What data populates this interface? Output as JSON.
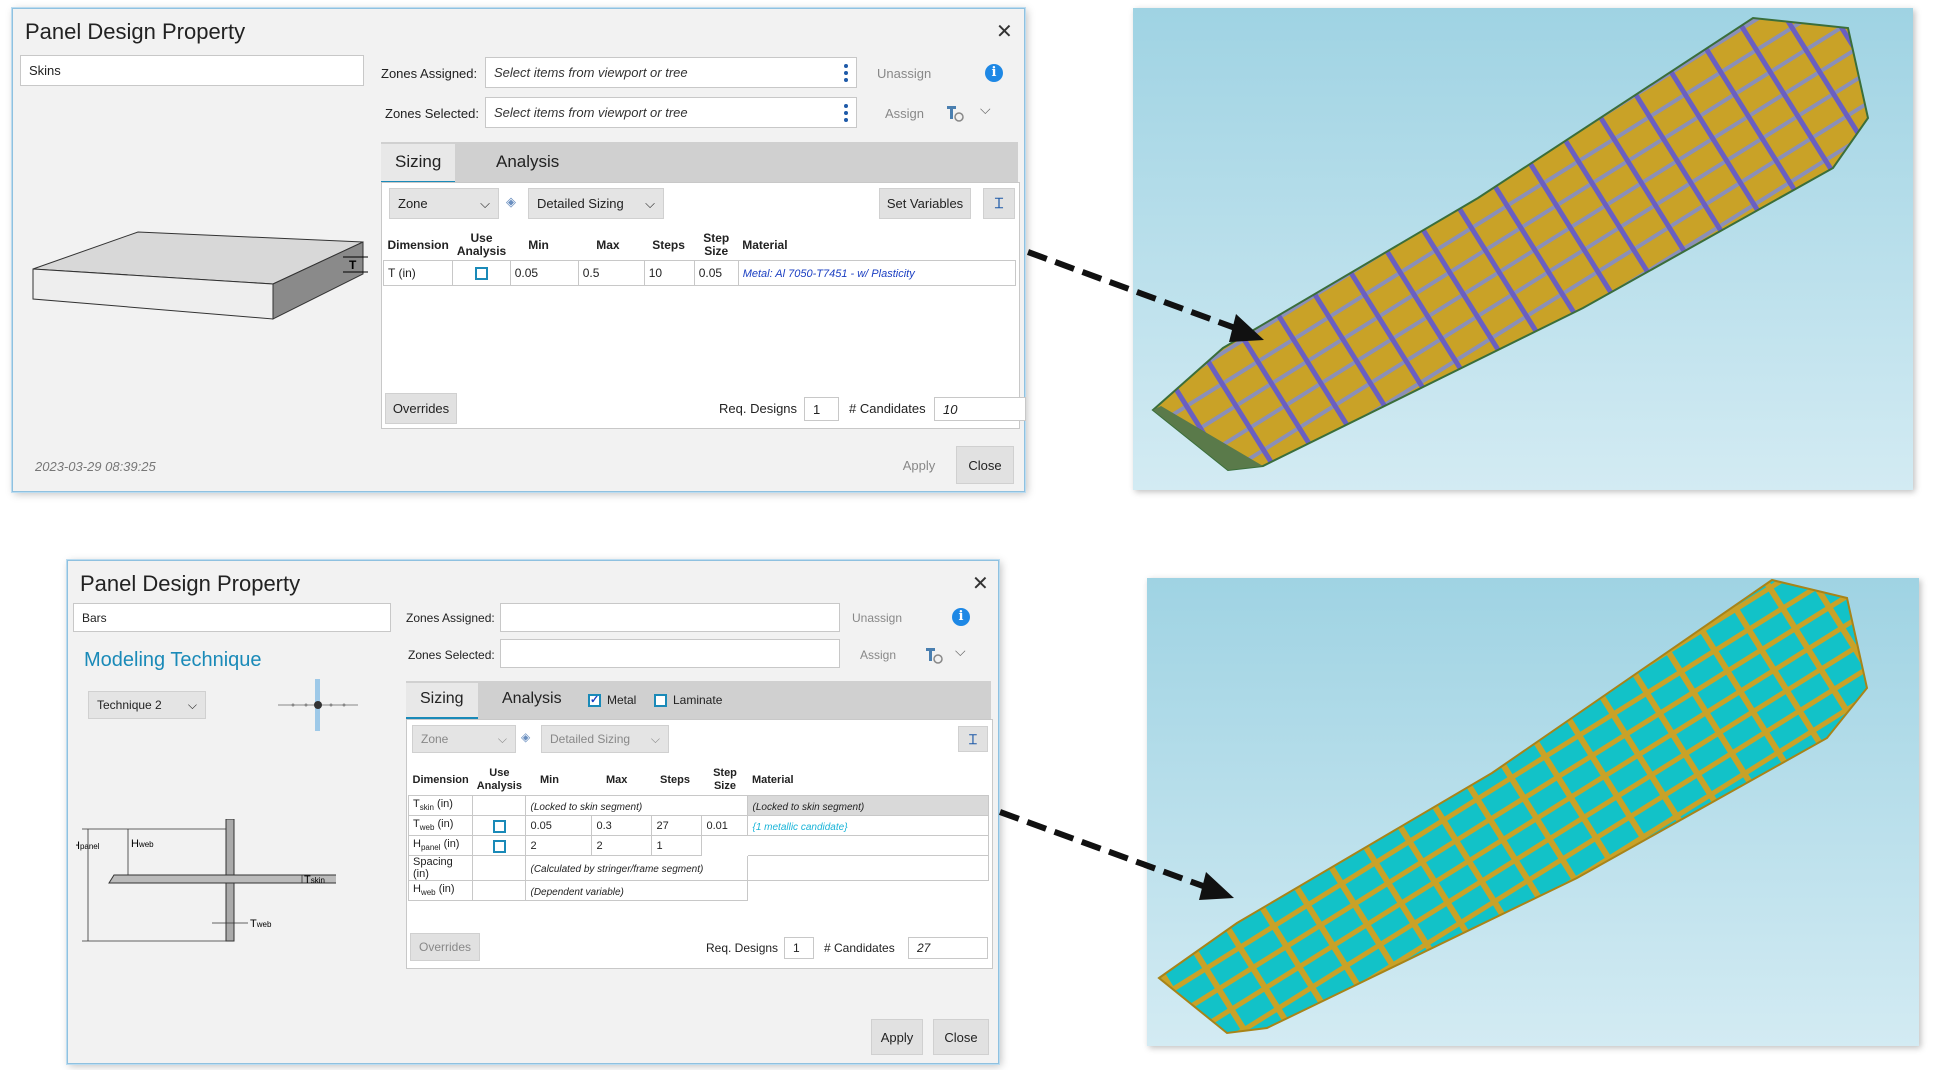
{
  "dialog1": {
    "title": "Panel Design Property",
    "close_glyph": "✕",
    "name_value": "Skins",
    "zones_assigned_label": "Zones Assigned:",
    "zones_assigned_placeholder": "Select items from viewport or tree",
    "zones_selected_label": "Zones Selected:",
    "zones_selected_placeholder": "Select items from viewport or tree",
    "unassign_label": "Unassign",
    "assign_label": "Assign",
    "info_glyph": "i",
    "tabs": [
      "Sizing",
      "Analysis"
    ],
    "zone_dropdown": "Zone",
    "sizing_dropdown": "Detailed Sizing",
    "set_variables_label": "Set Variables",
    "table_headers": [
      "Dimension",
      "Use Analysis",
      "Min",
      "Max",
      "Steps",
      "Step Size",
      "Material"
    ],
    "rows": [
      {
        "dimension": "T (in)",
        "min": "0.05",
        "max": "0.5",
        "steps": "10",
        "step_size": "0.05",
        "material": "Metal: Al 7050-T7451 - w/ Plasticity"
      }
    ],
    "overrides_label": "Overrides",
    "req_designs_label": "Req. Designs",
    "req_designs_value": "1",
    "candidates_label": "# Candidates",
    "candidates_value": "10",
    "timestamp": "2023-03-29 08:39:25",
    "apply_label": "Apply",
    "close_label": "Close",
    "dimension_marker": "T"
  },
  "dialog2": {
    "title": "Panel Design Property",
    "close_glyph": "✕",
    "name_value": "Bars",
    "zones_assigned_label": "Zones Assigned:",
    "zones_selected_label": "Zones Selected:",
    "unassign_label": "Unassign",
    "assign_label": "Assign",
    "info_glyph": "i",
    "modeling_technique_heading": "Modeling Technique",
    "technique_dropdown": "Technique 2",
    "tabs": [
      "Sizing",
      "Analysis"
    ],
    "metal_label": "Metal",
    "laminate_label": "Laminate",
    "zone_dropdown": "Zone",
    "sizing_dropdown": "Detailed Sizing",
    "table_headers": [
      "Dimension",
      "Use Analysis",
      "Min",
      "Max",
      "Steps",
      "Step Size",
      "Material"
    ],
    "rows": [
      {
        "dim": "T",
        "sub": "skin",
        "unit": " (in)",
        "note": "(Locked to skin segment)",
        "material": "(Locked to skin segment)"
      },
      {
        "dim": "T",
        "sub": "web",
        "unit": " (in)",
        "min": "0.05",
        "max": "0.3",
        "steps": "27",
        "step_size": "0.01",
        "material": "{1 metallic candidate}"
      },
      {
        "dim": "H",
        "sub": "panel",
        "unit": " (in)",
        "min": "2",
        "max": "2",
        "steps": "1"
      },
      {
        "dim": "Spacing",
        "sub": "",
        "unit": " (in)",
        "note": "(Calculated by stringer/frame segment)"
      },
      {
        "dim": "H",
        "sub": "web",
        "unit": " (in)",
        "note": "(Dependent variable)"
      }
    ],
    "overrides_label": "Overrides",
    "req_designs_label": "Req. Designs",
    "req_designs_value": "1",
    "candidates_label": "# Candidates",
    "candidates_value": "27",
    "apply_label": "Apply",
    "close_label": "Close",
    "diagram_labels": {
      "h_panel": "H",
      "h_panel_sub": "panel",
      "h_web": "H",
      "h_web_sub": "web",
      "t_skin": "T",
      "t_skin_sub": "skin",
      "t_web": "T",
      "t_web_sub": "web"
    }
  },
  "colors": {
    "accent": "#1a8ab8",
    "info_blue": "#1e88e5",
    "material_link": "#1a3ec2",
    "candidate_link": "#18b4d8",
    "skin_gold": "#c9a227",
    "skin_cyan": "#12c2c8",
    "viewport_bg": "#a9d6e5"
  }
}
